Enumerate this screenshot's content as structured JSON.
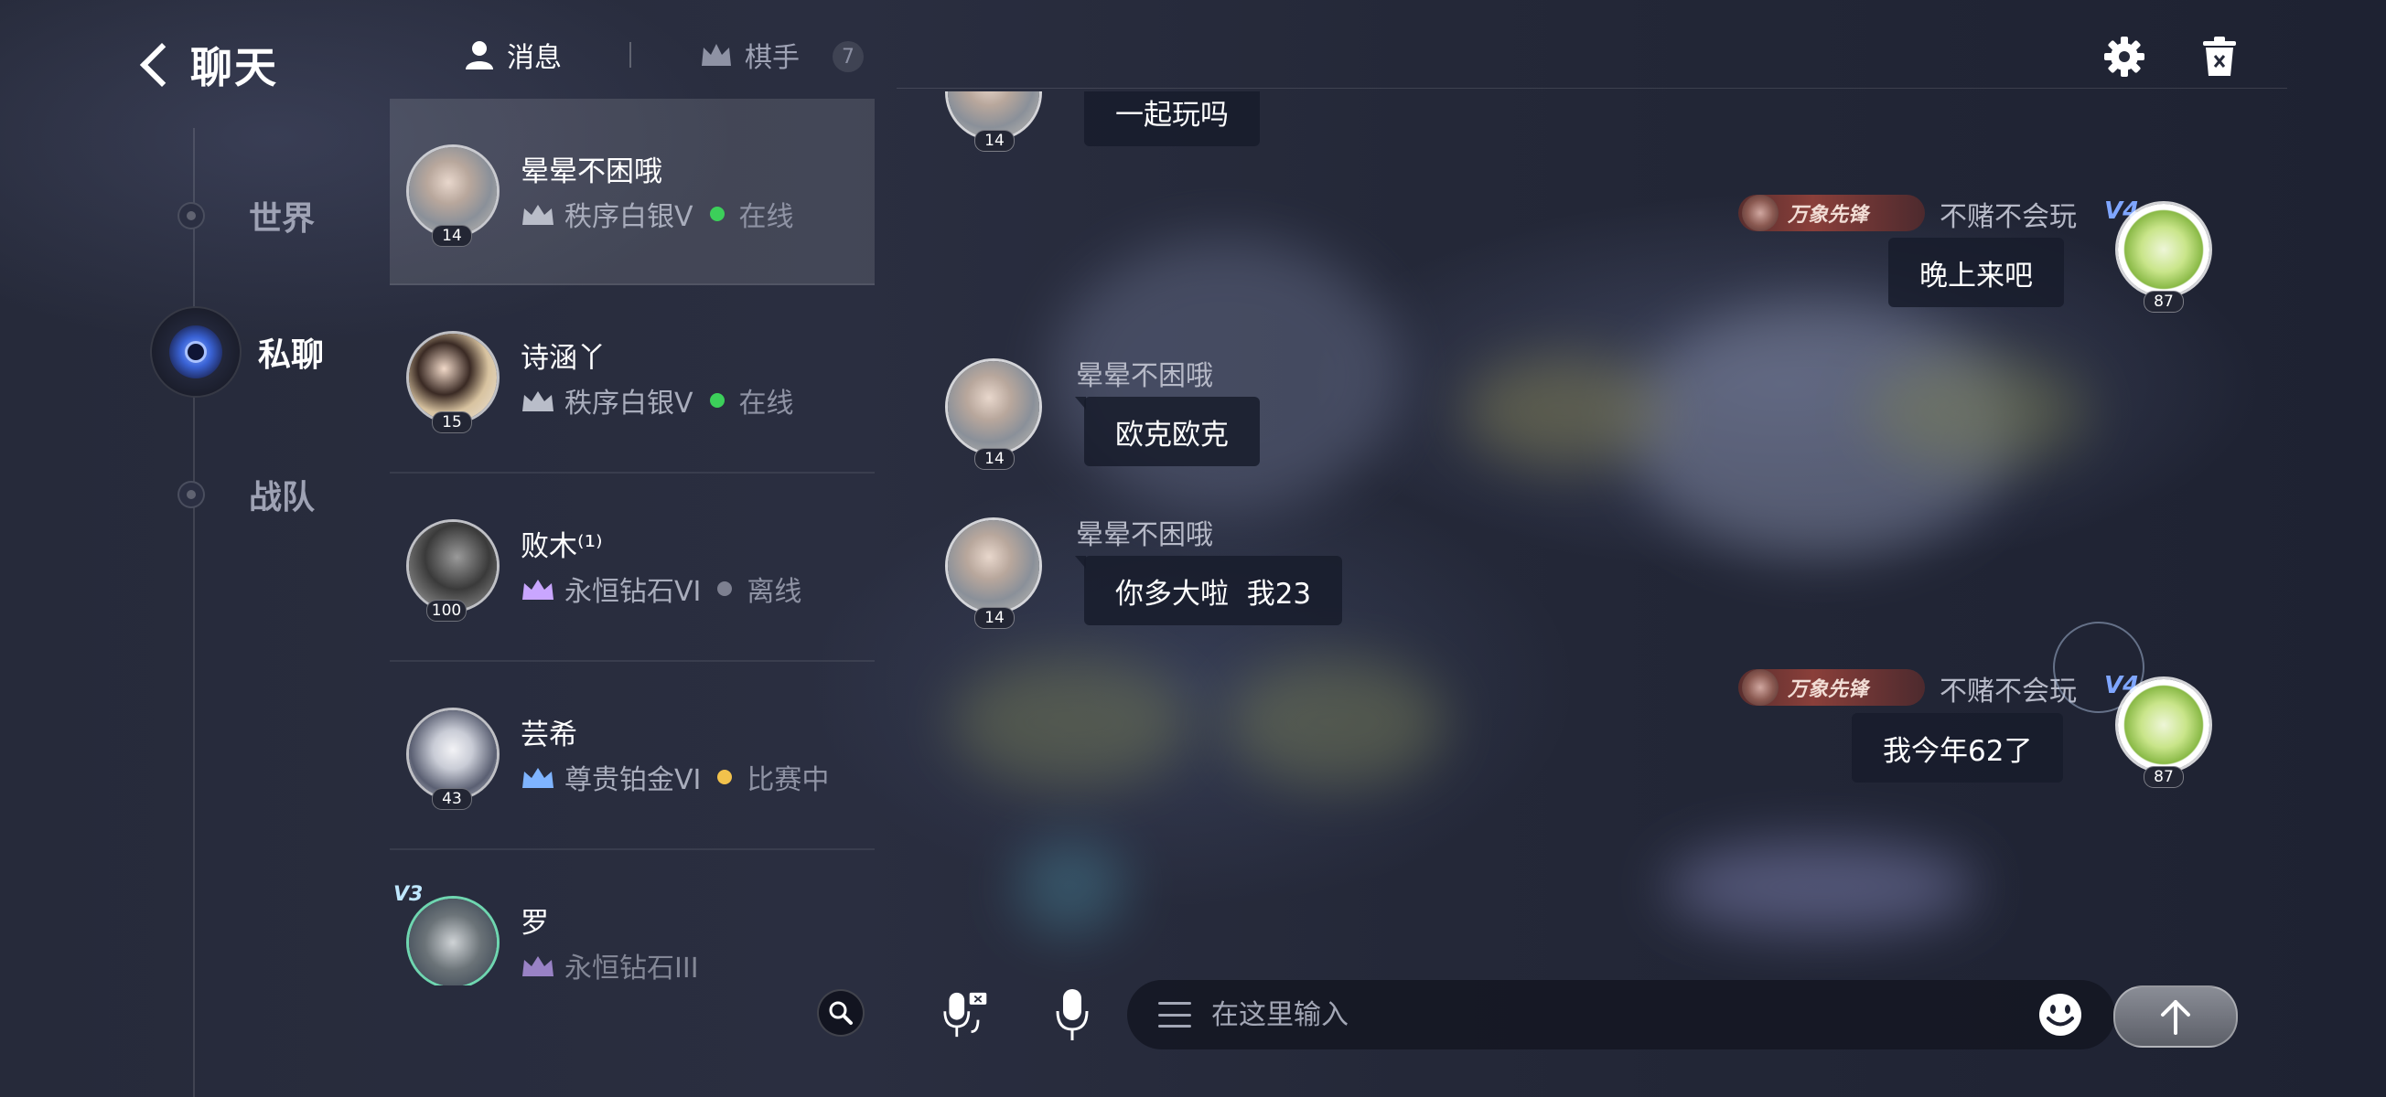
{
  "header": {
    "back_title": "聊天"
  },
  "nav": {
    "items": [
      {
        "label": "世界"
      },
      {
        "label": "私聊"
      },
      {
        "label": "战队"
      }
    ]
  },
  "tabs": {
    "messages": "消息",
    "players": "棋手",
    "players_count": "7"
  },
  "contacts": [
    {
      "name": "晕晕不困哦",
      "level": "14",
      "rank": "秩序白银V",
      "status": "在线",
      "status_color": "#3ccf5a",
      "crown_color": "#b9bdc9"
    },
    {
      "name": "诗涵丫",
      "level": "15",
      "rank": "秩序白银V",
      "status": "在线",
      "status_color": "#3ccf5a",
      "crown_color": "#b9bdc9"
    },
    {
      "name": "败木⁽¹⁾",
      "level": "100",
      "rank": "永恒钻石VI",
      "status": "离线",
      "status_color": "#7d8090",
      "crown_color": "#c9a6ff"
    },
    {
      "name": "芸希",
      "level": "43",
      "rank": "尊贵铂金VI",
      "status": "比赛中",
      "status_color": "#f2c24c",
      "crown_color": "#7fb4ff"
    },
    {
      "name": "罗",
      "vip": "V3",
      "rank": "永恒钻石III",
      "crown_color": "#c9a6ff"
    }
  ],
  "messages": [
    {
      "side": "left",
      "level": "14",
      "text": "一起玩吗"
    },
    {
      "side": "right",
      "title_badge": "万象先锋",
      "name": "不赌不会玩",
      "vip": "V4",
      "level": "87",
      "text": "晚上来吧"
    },
    {
      "side": "left",
      "name": "晕晕不困哦",
      "level": "14",
      "text": "欧克欧克"
    },
    {
      "side": "left",
      "name": "晕晕不困哦",
      "level": "14",
      "text": "你多大啦  我23"
    },
    {
      "side": "right",
      "title_badge": "万象先锋",
      "name": "不赌不会玩",
      "vip": "V4",
      "level": "87",
      "text": "我今年62了"
    }
  ],
  "input": {
    "placeholder": "在这里输入"
  },
  "icons": {
    "settings": "gear-icon",
    "delete": "trash-icon",
    "search": "search-icon",
    "voice_to_text": "voice-to-text-icon",
    "mic": "microphone-icon",
    "emoji": "emoji-icon",
    "send": "arrow-up-icon"
  }
}
